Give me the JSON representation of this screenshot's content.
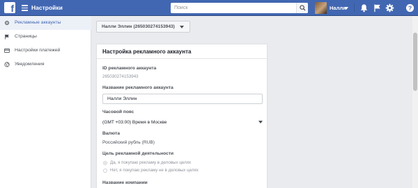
{
  "header": {
    "logo_glyph": "f",
    "title": "Настройки",
    "search_placeholder": "Поиск",
    "user_name": "Налли",
    "icons": [
      "hamburger-icon",
      "search-icon",
      "caret-down-icon",
      "bell-icon",
      "flag-icon",
      "gear-icon",
      "help-icon"
    ]
  },
  "sidebar": {
    "items": [
      {
        "label": "Рекламные аккаунты",
        "icon": "gear-icon",
        "active": true
      },
      {
        "label": "Страницы",
        "icon": "flag-icon",
        "active": false
      },
      {
        "label": "Настройки платежей",
        "icon": "credit-card-icon",
        "active": false
      },
      {
        "label": "Уведомления",
        "icon": "globe-icon",
        "active": false
      }
    ]
  },
  "account_selector": {
    "label": "Налли Эллин (265030274153943)"
  },
  "panel": {
    "title": "Настройка рекламного аккаунта",
    "account_id_label": "ID рекламного аккаунта",
    "account_id_value": "265030274153943",
    "account_name_label": "Название рекламного аккаунта",
    "account_name_value": "Налли Эллин",
    "timezone_label": "Часовой пояс",
    "timezone_value": "(GMT +03:00) Время в Москве",
    "currency_label": "Валюта",
    "currency_value": "Российский рубль (RUB)",
    "purpose_label": "Цель рекламной деятельности",
    "purpose_options": [
      {
        "label": "Да, я покупаю рекламу в деловых целях",
        "checked": true
      },
      {
        "label": "Нет, я покупаю рекламу не в деловых целях",
        "checked": false
      }
    ],
    "company_label": "Название компании"
  },
  "colors": {
    "brand": "#4267b2",
    "background": "#e9ebee",
    "sidebar_active": "#ecf0f7"
  }
}
